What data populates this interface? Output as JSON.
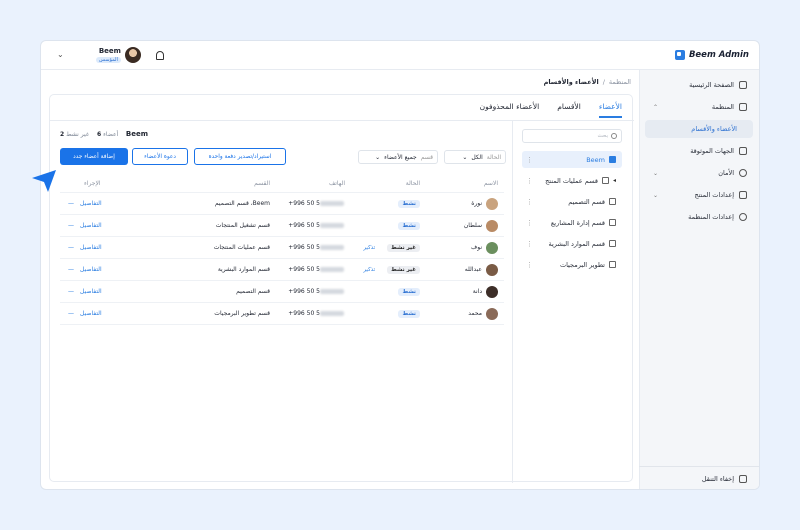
{
  "app": {
    "title": "Beem Admin"
  },
  "user": {
    "name": "Beem",
    "role": "المؤسس"
  },
  "sidebar": {
    "items": [
      {
        "label": "الصفحة الرئيسية",
        "icon": "home-icon"
      },
      {
        "label": "المنظمة",
        "icon": "org-icon",
        "expanded": true
      },
      {
        "label": "الأعضاء والأقسام",
        "icon": "",
        "active": true
      },
      {
        "label": "الجهات الموثوقة",
        "icon": "trusted-icon"
      },
      {
        "label": "الأمان",
        "icon": "shield-icon"
      },
      {
        "label": "إعدادات المنتج",
        "icon": "box-icon"
      },
      {
        "label": "إعدادات المنظمة",
        "icon": "gear-icon"
      }
    ],
    "collapse_label": "إخفاء التنقل"
  },
  "breadcrumb": {
    "root": "المنظمة",
    "sep": "/",
    "current": "الأعضاء والأقسام"
  },
  "tabs": [
    "الأعضاء",
    "الأقسام",
    "الأعضاء المحذوفون"
  ],
  "tree": {
    "search_placeholder": "بحث",
    "items": [
      "Beem",
      "قسم عمليات المنتج",
      "قسم التصميم",
      "قسم إدارة المشاريع",
      "قسم الموارد البشرية",
      "تطوير البرمجيات"
    ]
  },
  "members": {
    "org_name": "Beem",
    "members_label": "أعضاء",
    "members_count": "6",
    "inactive_label": "غير نشط",
    "inactive_count": "2",
    "filter_status_label": "الحالة",
    "filter_status_value": "الكل",
    "filter_dept_label": "قسم",
    "filter_dept_value": "جميع الأعضاء",
    "btn_import": "استيراد/تصدير دفعة واحدة",
    "btn_invite": "دعوة الأعضاء",
    "btn_add": "إضافة أعضاء جدد"
  },
  "table": {
    "headers": {
      "name": "الاسم",
      "status": "الحالة",
      "phone": "الهاتف",
      "dept": "القسم",
      "actions": "الإجراء"
    },
    "rows": [
      {
        "name": "نورة",
        "status": "نشط",
        "active": true,
        "remind": "",
        "phone": "+996 50 5",
        "dept": "قسم التصميم ،Beem",
        "action": "التفاصيل",
        "avatar": "#c9a37e"
      },
      {
        "name": "سلطان",
        "status": "نشط",
        "active": true,
        "remind": "",
        "phone": "+996 50 5",
        "dept": "قسم تشغيل المنتجات",
        "action": "التفاصيل",
        "avatar": "#b98b65"
      },
      {
        "name": "نوف",
        "status": "غير نشط",
        "active": false,
        "remind": "تذكير",
        "phone": "+996 50 5",
        "dept": "قسم عمليات المنتجات",
        "action": "التفاصيل",
        "avatar": "#6b8f5e"
      },
      {
        "name": "عبدالله",
        "status": "غير نشط",
        "active": false,
        "remind": "تذكير",
        "phone": "+996 50 5",
        "dept": "قسم الموارد البشرية",
        "action": "التفاصيل",
        "avatar": "#7a5b45"
      },
      {
        "name": "دانة",
        "status": "نشط",
        "active": true,
        "remind": "",
        "phone": "+996 50 5",
        "dept": "قسم التصميم",
        "action": "التفاصيل",
        "avatar": "#3d2e28"
      },
      {
        "name": "محمد",
        "status": "نشط",
        "active": true,
        "remind": "",
        "phone": "+996 50 5",
        "dept": "قسم تطوير البرمجيات",
        "action": "التفاصيل",
        "avatar": "#8a6a58"
      }
    ]
  },
  "colors": {
    "accent": "#1a73e8",
    "sidebar_bg": "#f4f6f9",
    "page_bg": "#eaf2fd"
  }
}
